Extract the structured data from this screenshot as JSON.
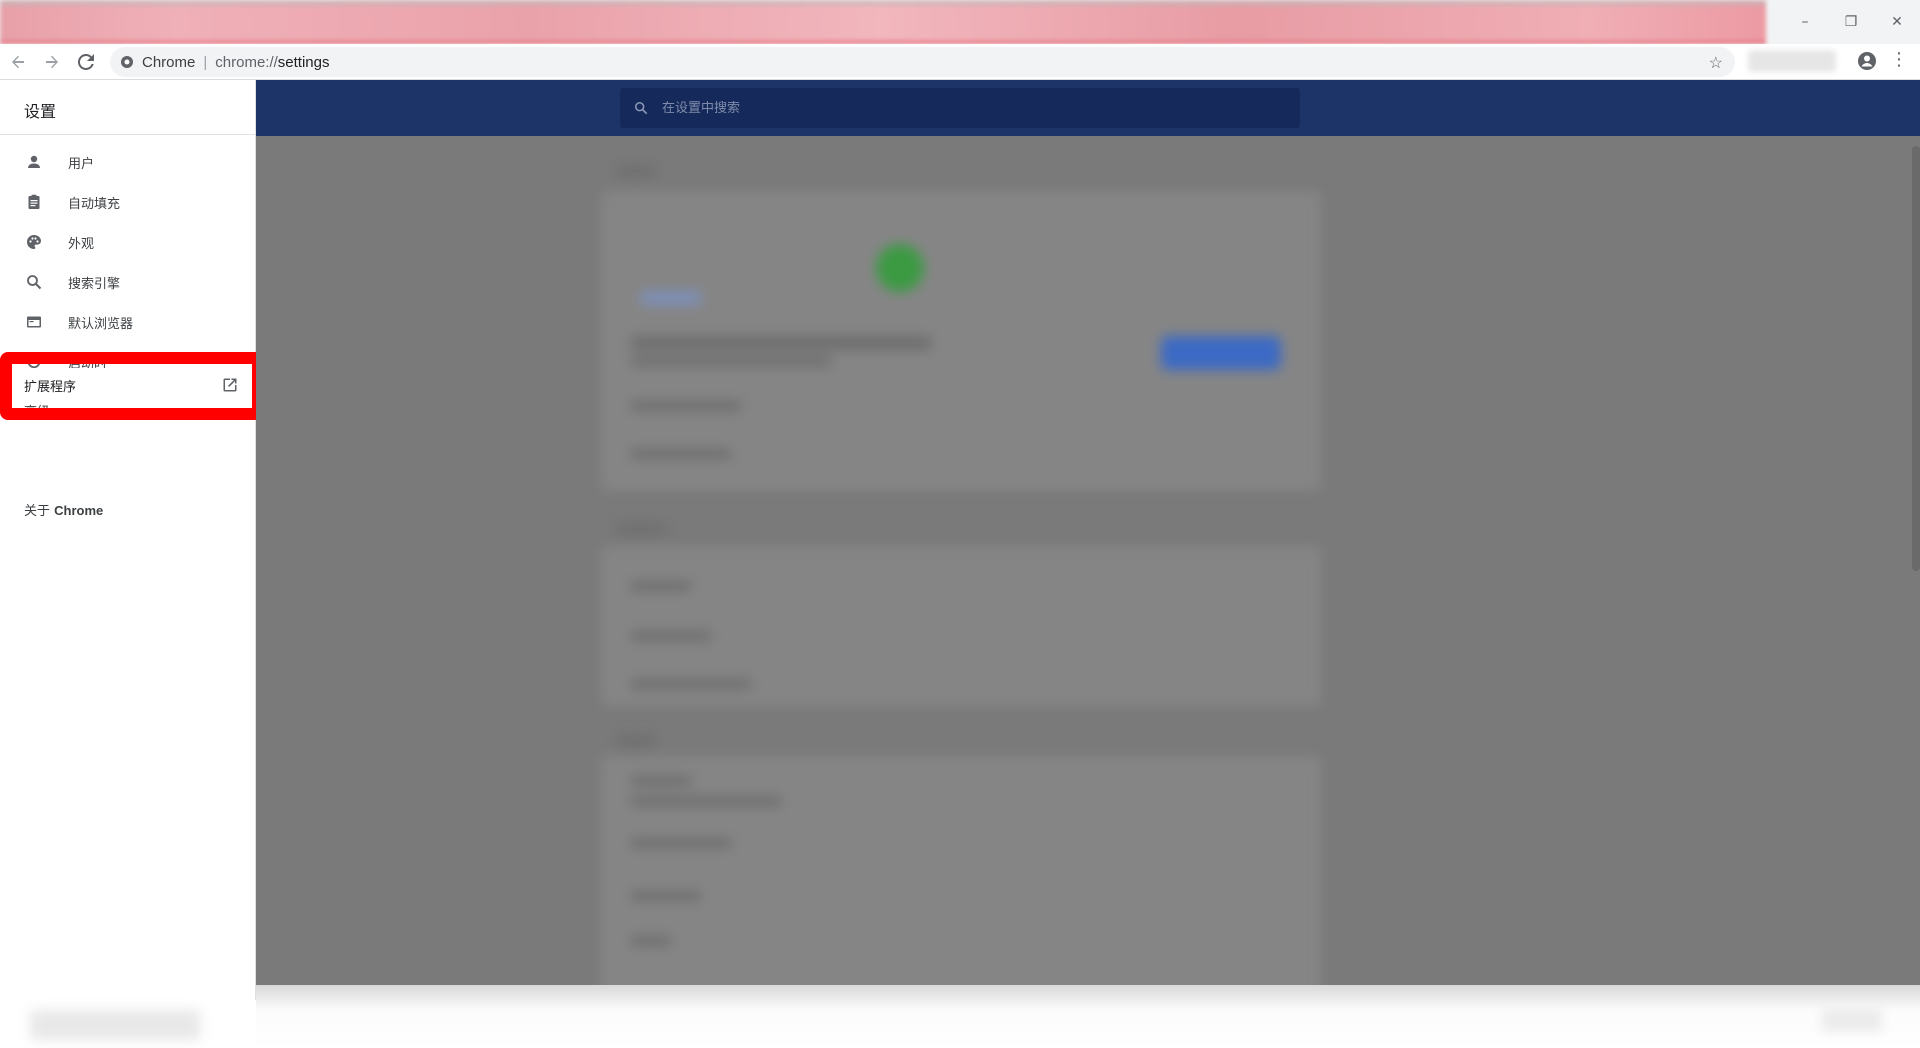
{
  "window": {
    "minimize_glyph": "–",
    "restore_glyph": "❐",
    "close_glyph": "✕"
  },
  "toolbar": {
    "back_icon": "arrow-left-icon",
    "forward_icon": "arrow-right-icon",
    "reload_icon": "reload-icon",
    "site_name": "Chrome",
    "url_scheme": "chrome://",
    "url_host": "settings",
    "star_icon": "star-icon"
  },
  "sidebar": {
    "title": "设置",
    "items": [
      {
        "label": "用户",
        "icon": "person-icon"
      },
      {
        "label": "自动填充",
        "icon": "clipboard-icon"
      },
      {
        "label": "外观",
        "icon": "palette-icon"
      },
      {
        "label": "搜索引擎",
        "icon": "search-icon"
      },
      {
        "label": "默认浏览器",
        "icon": "browser-window-icon"
      },
      {
        "label": "启动时",
        "icon": "power-icon"
      }
    ],
    "advanced_label": "高级",
    "extensions_label": "扩展程序",
    "about_prefix": "关于 ",
    "about_name": "Chrome"
  },
  "header": {
    "search_placeholder": "在设置中搜索"
  },
  "colors": {
    "header_band": "#1d3468",
    "highlight": "#ff0000",
    "overlay": "#7a7a7a"
  }
}
